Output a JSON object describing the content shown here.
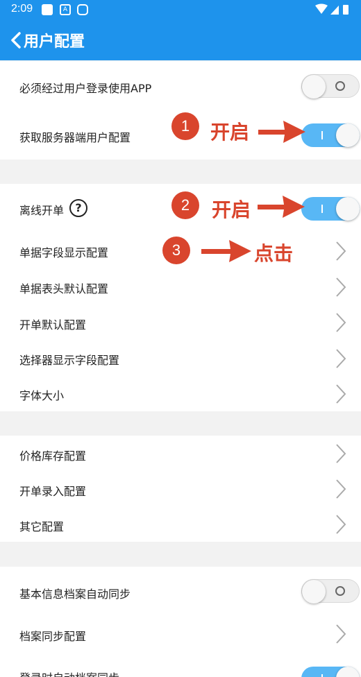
{
  "status_bar": {
    "time": "2:09",
    "icon_labels": [
      "A"
    ]
  },
  "header": {
    "title": "用户配置"
  },
  "sections": {
    "login": {
      "must_login_label": "必须经过用户登录使用APP",
      "must_login_state": "off",
      "fetch_server_config_label": "获取服务器端用户配置",
      "fetch_server_config_state": "on"
    },
    "offline": {
      "offline_order_label": "离线开单",
      "offline_order_state": "on",
      "help_glyph": "?",
      "items": [
        "单据字段显示配置",
        "单据表头默认配置",
        "开单默认配置",
        "选择器显示字段配置",
        "字体大小"
      ]
    },
    "misc": {
      "items": [
        "价格库存配置",
        "开单录入配置",
        "其它配置"
      ]
    },
    "sync": {
      "basic_sync_label": "基本信息档案自动同步",
      "basic_sync_state": "off",
      "archive_sync_label": "档案同步配置",
      "login_sync_label": "登录时自动档案同步",
      "login_sync_state": "on"
    }
  },
  "annotations": [
    {
      "number": "1",
      "text": "开启"
    },
    {
      "number": "2",
      "text": "开启"
    },
    {
      "number": "3",
      "text": "点击"
    }
  ],
  "colors": {
    "header_blue": "#1e93ec",
    "toggle_on": "#58b7f5",
    "annotation_red": "#d9452d"
  }
}
